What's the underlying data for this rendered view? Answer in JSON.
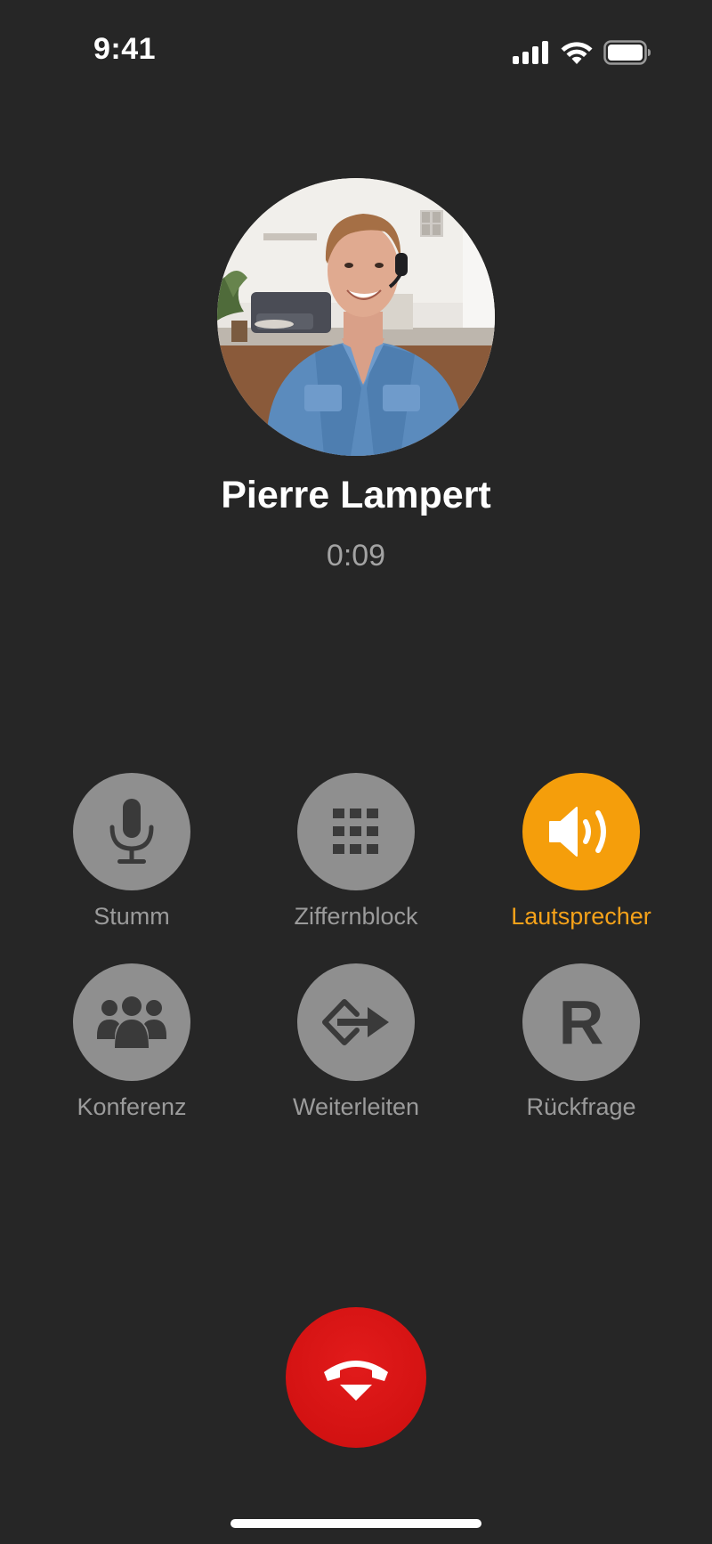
{
  "status_bar": {
    "time": "9:41",
    "icons": [
      "cellular-signal-icon",
      "wifi-icon",
      "battery-icon"
    ]
  },
  "caller": {
    "name": "Pierre Lampert",
    "duration": "0:09"
  },
  "controls": [
    {
      "id": "mute",
      "label": "Stumm",
      "icon": "microphone-icon",
      "active": false
    },
    {
      "id": "keypad",
      "label": "Ziffernblock",
      "icon": "keypad-icon",
      "active": false
    },
    {
      "id": "speaker",
      "label": "Lautsprecher",
      "icon": "speaker-icon",
      "active": true
    },
    {
      "id": "conference",
      "label": "Konferenz",
      "icon": "conference-icon",
      "active": false
    },
    {
      "id": "forward",
      "label": "Weiterleiten",
      "icon": "forward-icon",
      "active": false
    },
    {
      "id": "consult",
      "label": "Rückfrage",
      "icon": "consult-icon",
      "active": false,
      "glyph": "R"
    }
  ],
  "end_call": {
    "icon": "hang-up-icon"
  },
  "colors": {
    "background": "#262626",
    "control_inactive": "#8f8f8f",
    "control_active": "#f59e0b",
    "active_label": "#f5a21a",
    "end_call": "#d31212"
  }
}
